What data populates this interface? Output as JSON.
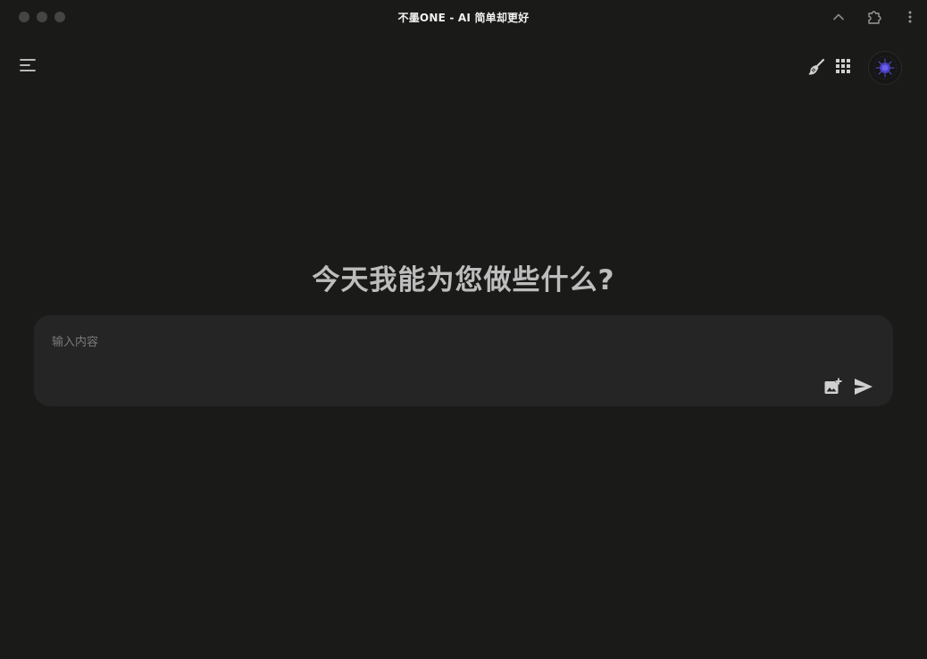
{
  "window": {
    "title": "不墨ONE - AI 简单却更好"
  },
  "icons": {
    "titlebar_chevron": "chevron-up-icon",
    "titlebar_extension": "puzzle-icon",
    "titlebar_more": "more-vertical-icon",
    "menu": "menu-icon",
    "clean": "broom-icon",
    "apps": "grid-icon",
    "avatar": "avatar-icon",
    "image_upload": "add-image-icon",
    "send": "send-icon"
  },
  "main": {
    "heading": "今天我能为您做些什么?"
  },
  "composer": {
    "value": "",
    "placeholder": "输入内容"
  },
  "colors": {
    "background": "#1a1a19",
    "input_background": "#252525",
    "icon": "#cfcfcf",
    "heading": "#bdbdbd",
    "avatar_accent": "#4b3fbf"
  }
}
